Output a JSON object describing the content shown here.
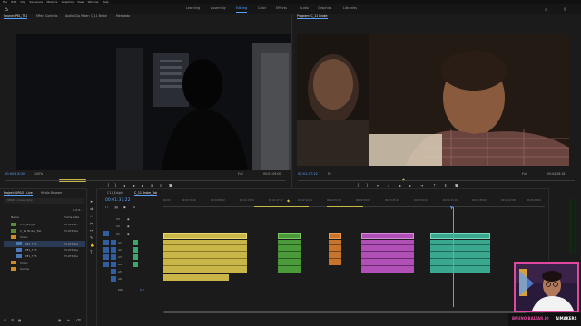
{
  "menu": [
    "File",
    "Edit",
    "Clip",
    "Sequence",
    "Markers",
    "Graphics",
    "View",
    "Window",
    "Help"
  ],
  "workspaces": [
    "Learning",
    "Assembly",
    "Editing",
    "Color",
    "Effects",
    "Audio",
    "Graphics",
    "Libraries"
  ],
  "active_workspace": "Editing",
  "source_monitor": {
    "tabs": [
      "Source: PEL_TE1",
      "Effect Controls",
      "Audio Clip Mixer: C_11 Broke",
      "Metadata"
    ],
    "timecode": "00:00:13:00",
    "zoom": "100%",
    "fit": "Full",
    "duration": "00:01:09:00"
  },
  "program_monitor": {
    "tab": "Program: C_11 Broke",
    "timecode": "00:01:37:22",
    "fit": "Fit",
    "fit2": "Full",
    "duration": "00:04:26:18"
  },
  "project": {
    "tabs": [
      "Project: URSO - Live",
      "Media Browser"
    ],
    "search_placeholder": "URSO - Live.prproj",
    "count": "1 of 9...",
    "columns": [
      "Name",
      "Frame Rate"
    ],
    "items": [
      {
        "name": "C11_Edight",
        "rate": "23.976 fps"
      },
      {
        "name": "C_11 Broke_Tob",
        "rate": "23.976 fps"
      },
      {
        "name": "Video",
        "rate": ""
      },
      {
        "name": "PEL_TE1",
        "rate": "23.976 fps"
      },
      {
        "name": "PEL_TE3",
        "rate": "23.976 fps"
      },
      {
        "name": "PEL_TE5",
        "rate": "23.976 fps"
      },
      {
        "name": "Video",
        "rate": ""
      },
      {
        "name": "Audios",
        "rate": ""
      }
    ]
  },
  "timeline": {
    "tabs": [
      "C11_Edight",
      "C_11 Broke_Tob"
    ],
    "timecode": "00:01:37:22",
    "ruler": [
      "00:00",
      "00:00:34:16",
      "00:00:58:02",
      "00:01:23:00",
      "00:01:47:12",
      "00:02:10:04",
      "00:02:34:12",
      "00:02:58:02",
      "00:03:25:11",
      "00:03:49:11",
      "00:04:13:16",
      "00:04:38:02",
      "00:05:02:08",
      "00:05:26:00"
    ],
    "tracks_video": [
      "V3",
      "V2",
      "V1"
    ],
    "tracks_audio": [
      "A1",
      "A2",
      "A3",
      "A4",
      "A5",
      "A6"
    ],
    "master": "Mix",
    "master_val": "0.0",
    "playhead_fraction": 0.76
  },
  "overlay": {
    "name": "BRUNO BALTAR.IO",
    "brand": "AIMAKERS"
  },
  "colors": {
    "accent": "#5aa0ff",
    "yellow_clip": "#d8c24a",
    "green_clip": "#4b9a3a",
    "orange_clip": "#c8742a",
    "magenta_clip": "#b04fb5",
    "teal_clip": "#3aa88f",
    "overlay_border": "#e0479e"
  }
}
